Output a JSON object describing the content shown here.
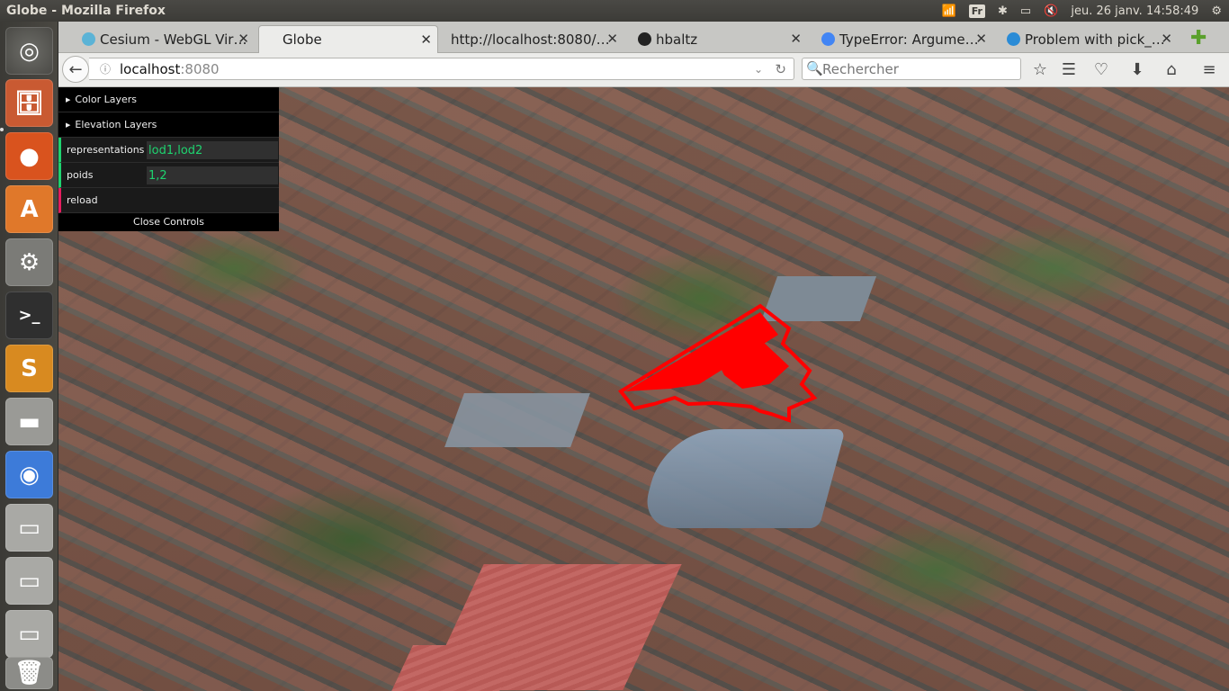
{
  "topbar": {
    "title": "Globe - Mozilla Firefox",
    "lang": "Fr",
    "datetime": "jeu. 26 janv. 14:58:49"
  },
  "tabs": [
    {
      "label": "Cesium - WebGL Vir…"
    },
    {
      "label": "Globe"
    },
    {
      "label": "http://localhost:8080/…"
    },
    {
      "label": "hbaltz"
    },
    {
      "label": "TypeError: Argume…"
    },
    {
      "label": "Problem with pick_…"
    }
  ],
  "nav": {
    "url_host": "localhost",
    "url_port": ":8080",
    "search_placeholder": "Rechercher"
  },
  "gui": {
    "color_layers": "Color Layers",
    "elevation_layers": "Elevation Layers",
    "representations_label": "representations",
    "representations_value": "lod1,lod2",
    "poids_label": "poids",
    "poids_value": "1,2",
    "reload_label": "reload",
    "close_label": "Close Controls"
  },
  "colors": {
    "accent_string": "#1ed36f",
    "accent_function": "#e61d5f",
    "building_highlight": "#ff0000"
  }
}
